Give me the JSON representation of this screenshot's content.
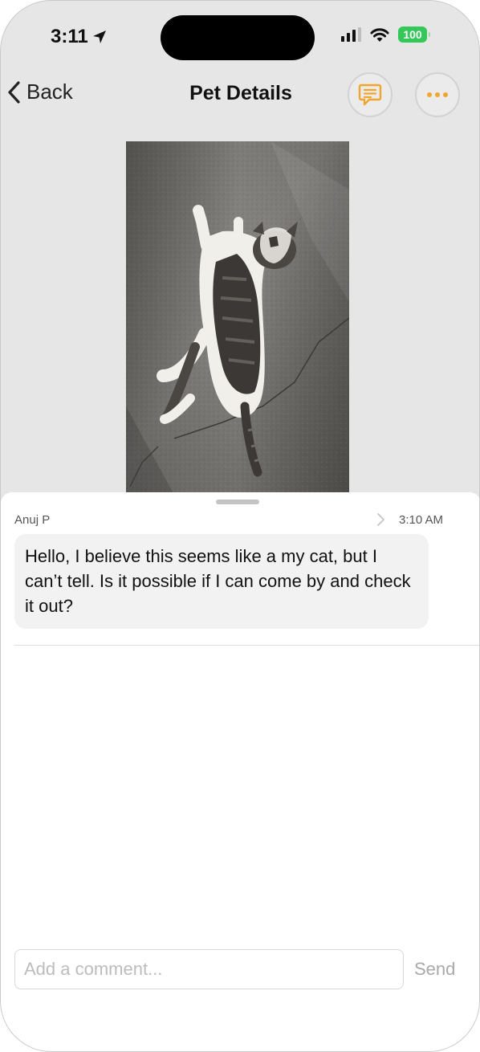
{
  "status_bar": {
    "time": "3:11",
    "battery": "100"
  },
  "nav": {
    "back_label": "Back",
    "title": "Pet Details"
  },
  "comment": {
    "author": "Anuj P",
    "time": "3:10 AM",
    "text": "Hello, I believe this seems like a my cat, but I can’t tell. Is it possible if I can come by and check it out?"
  },
  "composer": {
    "placeholder": "Add a comment...",
    "value": "",
    "send_label": "Send"
  },
  "colors": {
    "accent": "#f0a52c",
    "accent_dark": "#d98a12",
    "battery": "#34c759"
  }
}
